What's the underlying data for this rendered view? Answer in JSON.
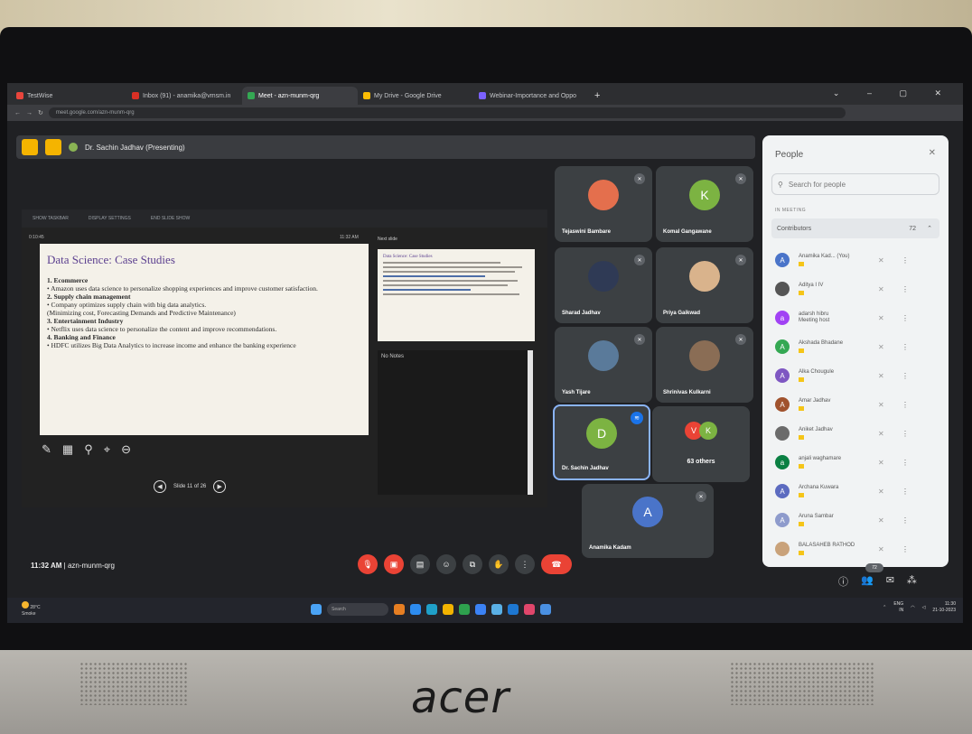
{
  "browser": {
    "tabs": [
      {
        "label": "TestWise",
        "color": "#e8453c"
      },
      {
        "label": "Inbox (91) - anamika@vmsm.in",
        "color": "#d93025"
      },
      {
        "label": "Meet - azn-munm-qrg",
        "color": "#34a853",
        "active": true
      },
      {
        "label": "My Drive - Google Drive",
        "color": "#fbbc04"
      },
      {
        "label": "Webinar-Importance and Oppo",
        "color": "#7b61ff"
      }
    ],
    "url": "meet.google.com/azn-munm-qrg"
  },
  "meet": {
    "presenting_banner": "Dr. Sachin Jadhav (Presenting)",
    "meeting_time": "11:32 AM",
    "meeting_code": "azn-munm-qrg"
  },
  "presenter_view": {
    "toolbar": [
      "SHOW TASKBAR",
      "DISPLAY SETTINGS",
      "END SLIDE SHOW"
    ],
    "elapsed": "0:10:45",
    "clock": "11:32 AM",
    "next_slide_label": "Next slide",
    "notes_label": "No Notes",
    "slide_counter": "Slide 11 of 26",
    "slide": {
      "title": "Data Science:  Case Studies",
      "lines": [
        {
          "text": "1. Ecommerce",
          "heading": true
        },
        {
          "text": "• Amazon uses data science to personalize shopping experiences and improve customer satisfaction.",
          "heading": false
        },
        {
          "text": "2. Supply chain management",
          "heading": true
        },
        {
          "text": "• Company optimizes supply chain with big data analytics.",
          "heading": false
        },
        {
          "text": "(Minimizing cost, Forecasting Demands and Predictive Maintenance)",
          "heading": false
        },
        {
          "text": "3. Entertainment Industry",
          "heading": true
        },
        {
          "text": "• Netflix uses data science to personalize the content and improve recommendations.",
          "heading": false
        },
        {
          "text": "4. Banking and Finance",
          "heading": true
        },
        {
          "text": "• HDFC utilizes Big Data Analytics to increase income and enhance the banking experience",
          "heading": false
        }
      ]
    },
    "next_slide_title": "Data Science:  Case Studies"
  },
  "tiles": [
    {
      "name": "Tejaswini Bambare",
      "avatar_color": "#e46f4d",
      "initial": ""
    },
    {
      "name": "Komal Gangawane",
      "avatar_color": "#7cb342",
      "initial": "K"
    },
    {
      "name": "Sharad Jadhav",
      "avatar_color": "#2f3a55",
      "initial": ""
    },
    {
      "name": "Priya Gaikwad",
      "avatar_color": "#d9b38c",
      "initial": ""
    },
    {
      "name": "Yash Tijare",
      "avatar_color": "#5a7a9a",
      "initial": ""
    },
    {
      "name": "Shrinivas Kulkarni",
      "avatar_color": "#8a6d55",
      "initial": ""
    },
    {
      "name": "Dr. Sachin Jadhav",
      "avatar_color": "#7cb342",
      "initial": "D"
    },
    {
      "name": "Anamika Kadam",
      "avatar_color": "#4a74c9",
      "initial": "A"
    }
  ],
  "others": {
    "label": "63 others",
    "a": "V",
    "b": "K"
  },
  "people": {
    "title": "People",
    "search_placeholder": "Search for people",
    "section": "IN MEETING",
    "group": "Contributors",
    "count": "72",
    "list": [
      {
        "name": "Anamika Kad... (You)",
        "initial": "A",
        "color": "#4a74c9"
      },
      {
        "name": "Aditya I IV",
        "initial": "",
        "color": "#555"
      },
      {
        "name": "adarsh hibru\nMeeting host",
        "initial": "a",
        "color": "#a142f4"
      },
      {
        "name": "Akshada Bhadane",
        "initial": "A",
        "color": "#34a853"
      },
      {
        "name": "Alka Chougule",
        "initial": "A",
        "color": "#7e57c2"
      },
      {
        "name": "Amar Jadhav",
        "initial": "A",
        "color": "#a0522d"
      },
      {
        "name": "Aniket Jadhav",
        "initial": "",
        "color": "#6b6b6b"
      },
      {
        "name": "anjali waghamare",
        "initial": "a",
        "color": "#0b8043"
      },
      {
        "name": "Archana Kuwara",
        "initial": "A",
        "color": "#5c6bc0"
      },
      {
        "name": "Aruna Sambar",
        "initial": "A",
        "color": "#8e9bcc"
      },
      {
        "name": "BALASAHEB RATHOD",
        "initial": "",
        "color": "#c9a27a"
      }
    ]
  },
  "controls": {
    "people_badge": "72"
  },
  "taskbar": {
    "weather_temp": "28°C",
    "weather_desc": "Smoke",
    "search": "Search",
    "lang": "ENG\nIN",
    "time": "11:30",
    "date": "21-10-2023"
  },
  "monitor_brand": "acer"
}
